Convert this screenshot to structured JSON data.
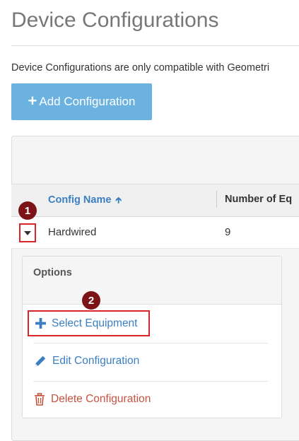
{
  "page": {
    "title": "Device Configurations",
    "intro": "Device Configurations are only compatible with Geometri"
  },
  "toolbar": {
    "add_label": "Add Configuration",
    "add_icon": "plus-icon"
  },
  "table": {
    "columns": [
      "Config Name",
      "Number of Eq"
    ],
    "sort_column": "Config Name",
    "sort_direction": "ascending",
    "rows": [
      {
        "name": "Hardwired",
        "count": "9"
      }
    ]
  },
  "options": {
    "title": "Options",
    "items": [
      {
        "label": "Select Equipment",
        "icon": "plus-icon",
        "color": "#3a7fc1"
      },
      {
        "label": "Edit Configuration",
        "icon": "pencil-icon",
        "color": "#3a7fc1"
      },
      {
        "label": "Delete Configuration",
        "icon": "trash-icon",
        "color": "#c6523f"
      }
    ]
  },
  "callouts": [
    "1",
    "2"
  ],
  "colors": {
    "accent": "#3a7fc1",
    "button": "#6cb2e0",
    "highlight": "#d9252a",
    "callout": "#7c1417",
    "danger": "#c6523f"
  }
}
